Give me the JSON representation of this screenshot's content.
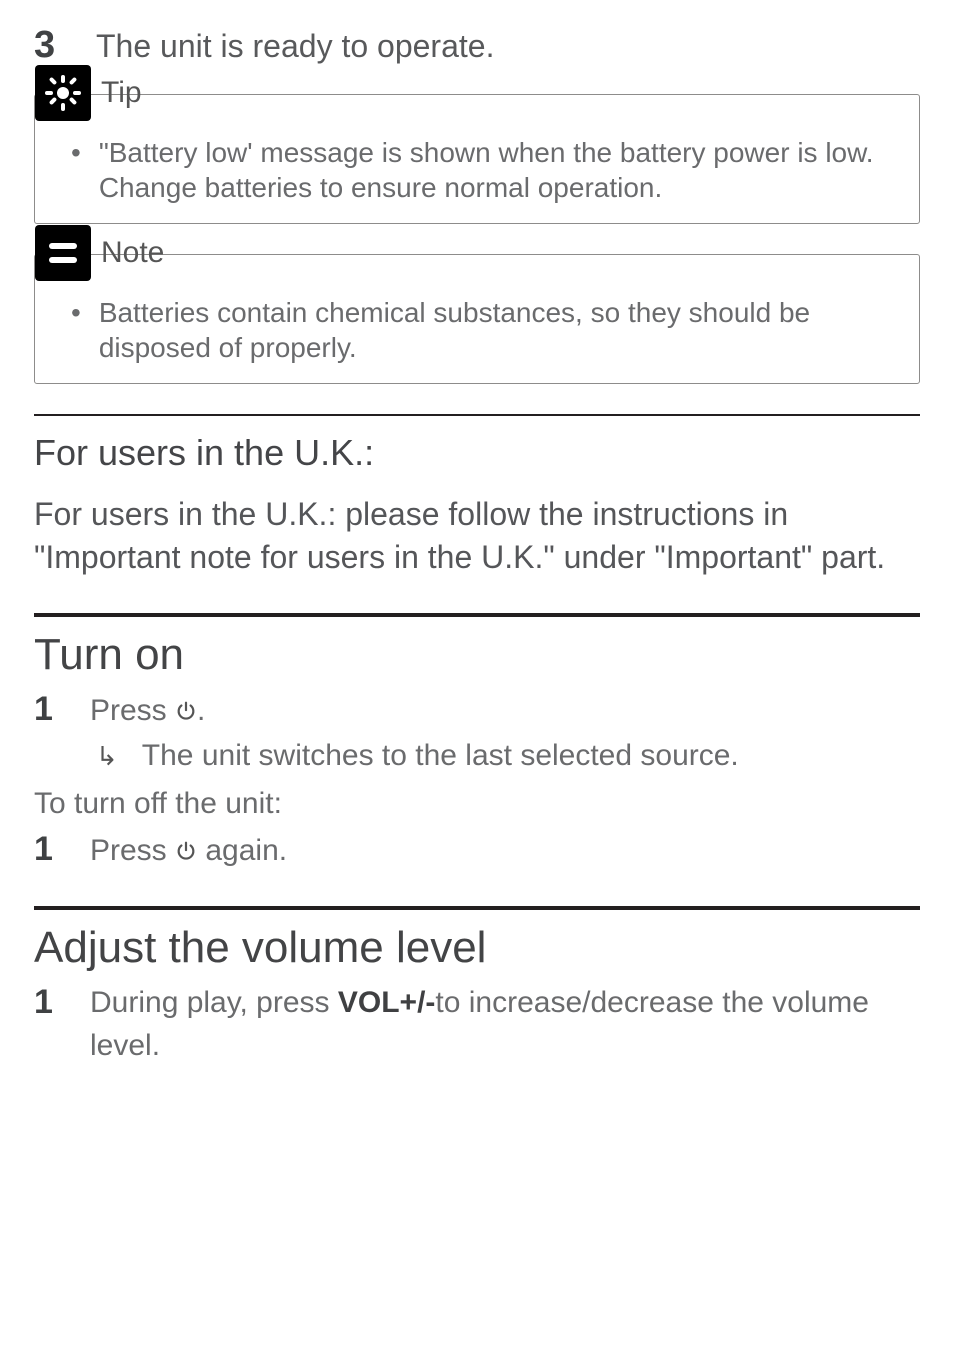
{
  "step3": {
    "num": "3",
    "text": "The unit is ready to operate."
  },
  "tip": {
    "label": "Tip",
    "bullet": "•",
    "text": "\"Battery low' message is shown when the battery power is low. Change batteries to ensure normal operation."
  },
  "note": {
    "label": "Note",
    "bullet": "•",
    "text": "Batteries contain chemical substances, so they should be disposed of properly."
  },
  "uk": {
    "heading": "For users in the U.K.:",
    "body": "For users in the U.K.: please follow the instructions in \"Important note for users in the U.K.\" under \"Important\" part."
  },
  "turn_on": {
    "heading": "Turn on",
    "step1_num": "1",
    "step1_pre": "Press ",
    "step1_post": ".",
    "result": "The unit switches to the last selected source.",
    "off_label": "To turn off the unit:",
    "step_off_num": "1",
    "step_off_pre": "Press ",
    "step_off_post": " again."
  },
  "volume": {
    "heading": "Adjust the volume level",
    "step1_num": "1",
    "step1_pre": "During play, press ",
    "step1_bold": "VOL+/-",
    "step1_post": "to increase/decrease the volume level."
  }
}
